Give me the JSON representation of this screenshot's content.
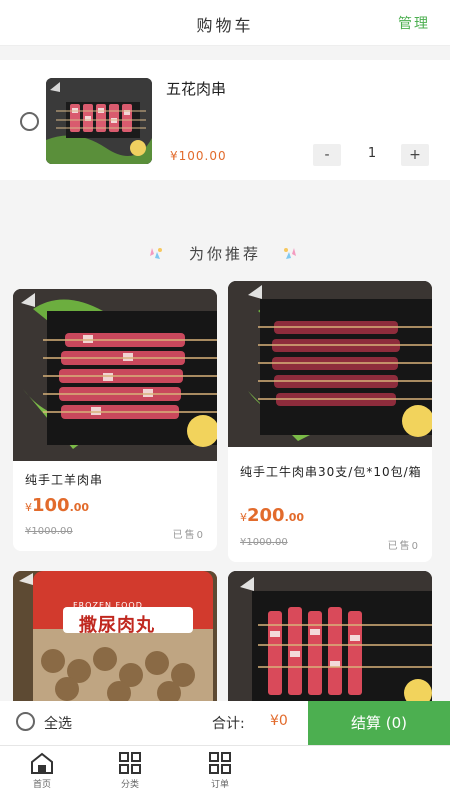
{
  "header": {
    "title": "购物车",
    "manage_label": "管理"
  },
  "cart": {
    "items": [
      {
        "name": "五花肉串",
        "price": "¥100.00",
        "quantity": "1"
      }
    ],
    "minus_label": "-",
    "plus_label": "+"
  },
  "recommend": {
    "title": "为你推荐",
    "products": [
      {
        "title": "纯手工羊肉串",
        "price_symbol": "¥",
        "price_int": "100",
        "price_dec": ".00",
        "original_price": "¥1000.00",
        "sold": "已售0"
      },
      {
        "title": "纯手工牛肉串30支/包*10包/箱",
        "price_symbol": "¥",
        "price_int": "200",
        "price_dec": ".00",
        "original_price": "¥1000.00",
        "sold": "已售0"
      },
      {
        "title": "",
        "package_brand": "FROZEN FOOD",
        "package_name": "撒尿肉丸"
      },
      {
        "title": ""
      }
    ]
  },
  "checkout": {
    "select_all_label": "全选",
    "total_label": "合计:",
    "total_value": "¥0",
    "button_label": "结算 (0)"
  },
  "tabbar": {
    "items": [
      {
        "label": "首页",
        "icon": "home-icon"
      },
      {
        "label": "分类",
        "icon": "grid-icon"
      },
      {
        "label": "订单",
        "icon": "grid-icon"
      }
    ]
  },
  "colors": {
    "accent_green": "#4caf50",
    "price_orange": "#e26b2c"
  }
}
